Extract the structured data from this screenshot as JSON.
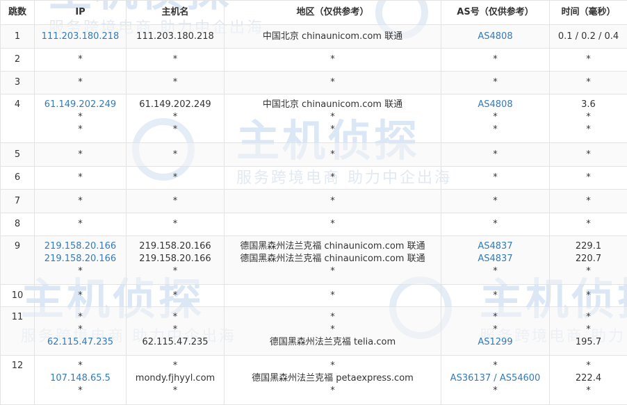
{
  "watermark": {
    "logo": "主机侦探",
    "slogan": "服务跨境电商 助力中企出海"
  },
  "colors": {
    "link": "#337ab7",
    "text": "#333333",
    "border": "#e3e3e3",
    "watermark": "#dbe7f4"
  },
  "headers": {
    "hop": "跳数",
    "ip": "IP",
    "hostname": "主机名",
    "region": "地区（仅供参考）",
    "as": "AS号（仅供参考）",
    "time": "时间（毫秒）"
  },
  "rows": [
    {
      "hop": "1",
      "ip": [
        "111.203.180.218"
      ],
      "hostname": [
        "111.203.180.218"
      ],
      "region": [
        "中国北京 chinaunicom.com 联通"
      ],
      "as": [
        "AS4808"
      ],
      "time": [
        "0.1 / 0.2 / 0.4"
      ]
    },
    {
      "hop": "2",
      "ip": [
        "*"
      ],
      "hostname": [
        "*"
      ],
      "region": [
        "*"
      ],
      "as": [
        "*"
      ],
      "time": [
        "*"
      ]
    },
    {
      "hop": "3",
      "ip": [
        "*"
      ],
      "hostname": [
        "*"
      ],
      "region": [
        "*"
      ],
      "as": [
        "*"
      ],
      "time": [
        "*"
      ]
    },
    {
      "hop": "4",
      "ip": [
        "61.149.202.249",
        "*",
        "*"
      ],
      "hostname": [
        "61.149.202.249",
        "*",
        "*"
      ],
      "region": [
        "中国北京 chinaunicom.com 联通",
        "*",
        "*"
      ],
      "as": [
        "AS4808",
        "*",
        "*"
      ],
      "time": [
        "3.6",
        "*",
        "*"
      ]
    },
    {
      "hop": "5",
      "ip": [
        "*"
      ],
      "hostname": [
        "*"
      ],
      "region": [
        "*"
      ],
      "as": [
        "*"
      ],
      "time": [
        "*"
      ]
    },
    {
      "hop": "6",
      "ip": [
        "*"
      ],
      "hostname": [
        "*"
      ],
      "region": [
        "*"
      ],
      "as": [
        "*"
      ],
      "time": [
        "*"
      ]
    },
    {
      "hop": "7",
      "ip": [
        "*"
      ],
      "hostname": [
        "*"
      ],
      "region": [
        "*"
      ],
      "as": [
        "*"
      ],
      "time": [
        "*"
      ]
    },
    {
      "hop": "8",
      "ip": [
        "*"
      ],
      "hostname": [
        "*"
      ],
      "region": [
        "*"
      ],
      "as": [
        "*"
      ],
      "time": [
        "*"
      ]
    },
    {
      "hop": "9",
      "ip": [
        "219.158.20.166",
        "219.158.20.166",
        "*"
      ],
      "hostname": [
        "219.158.20.166",
        "219.158.20.166",
        "*"
      ],
      "region": [
        "德国黑森州法兰克福 chinaunicom.com 联通",
        "德国黑森州法兰克福 chinaunicom.com 联通",
        "*"
      ],
      "as": [
        "AS4837",
        "AS4837",
        "*"
      ],
      "time": [
        "229.1",
        "220.7",
        "*"
      ]
    },
    {
      "hop": "10",
      "ip": [
        "*"
      ],
      "hostname": [
        "*"
      ],
      "region": [
        "*"
      ],
      "as": [
        "*"
      ],
      "time": [
        "*"
      ]
    },
    {
      "hop": "11",
      "ip": [
        "*",
        "*",
        "62.115.47.235"
      ],
      "hostname": [
        "*",
        "*",
        "62.115.47.235"
      ],
      "region": [
        "*",
        "*",
        "德国黑森州法兰克福 telia.com"
      ],
      "as": [
        "*",
        "*",
        "AS1299"
      ],
      "time": [
        "*",
        "*",
        "195.7"
      ]
    },
    {
      "hop": "12",
      "ip": [
        "*",
        "107.148.65.5",
        "*"
      ],
      "hostname": [
        "*",
        "mondy.fjhyyl.com",
        "*"
      ],
      "region": [
        "*",
        "德国黑森州法兰克福 petaexpress.com",
        "*"
      ],
      "as": [
        "*",
        "AS36137 / AS54600",
        "*"
      ],
      "time": [
        "*",
        "222.4",
        "*"
      ]
    }
  ]
}
